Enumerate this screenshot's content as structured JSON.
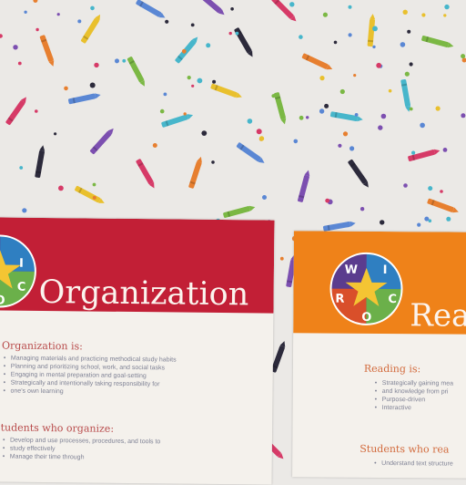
{
  "background": {
    "color": "#ebe9e6",
    "pattern": "confetti-crayons-and-dots",
    "crayon_colors": [
      "#d63a67",
      "#e77f2f",
      "#e9c02d",
      "#7bb844",
      "#47b6cb",
      "#5a87d4",
      "#7c4fb0",
      "#2c2a3b"
    ]
  },
  "posters": [
    {
      "title": "Organization",
      "banner_color": "#c21f36",
      "logo_letters": [
        "W",
        "I",
        "C",
        "O",
        "R"
      ],
      "section1_heading": "Organization is:",
      "section1_items": [
        "Managing materials and practicing methodical study habits",
        "Planning and prioritizing school, work, and social tasks",
        "Engaging in mental preparation and goal-setting",
        "Strategically and intentionally taking responsibility for",
        "one's own learning"
      ],
      "section2_heading": "Students who organize:",
      "section2_items": [
        "Develop and use processes, procedures, and tools to",
        "study effectively",
        "Manage their time through"
      ]
    },
    {
      "title": "Rea",
      "banner_color": "#ef8219",
      "logo_letters": [
        "W",
        "I",
        "C",
        "O",
        "R"
      ],
      "section1_heading": "Reading is:",
      "section1_items": [
        "Strategically gaining mea",
        "and knowledge from pri",
        "Purpose-driven",
        "Interactive"
      ],
      "section2_heading": "Students who rea",
      "section2_items": [
        "Understand text structure"
      ]
    }
  ]
}
